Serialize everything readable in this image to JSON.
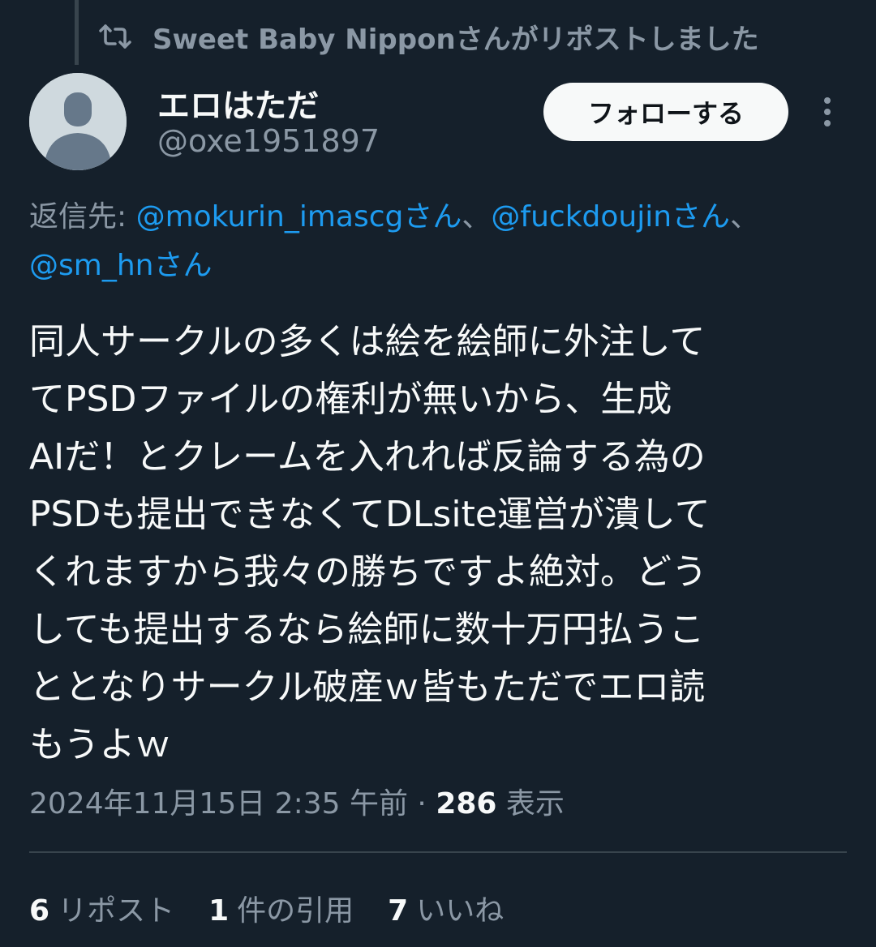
{
  "social_context": {
    "text": "Sweet Baby Nipponさんがリポストしました",
    "icon": "repost-icon"
  },
  "author": {
    "name": "エロはただ",
    "handle": "@oxe1951897",
    "avatar": "default-avatar"
  },
  "follow_button": {
    "label": "フォローする"
  },
  "more_menu": {
    "icon": "more-vertical-icon"
  },
  "reply_to": {
    "prefix": "返信先: ",
    "mentions": [
      "@mokurin_imascgさん",
      "@fuckdoujinさん",
      "@sm_hnさん"
    ],
    "separator": "、"
  },
  "tweet": {
    "lines": [
      "同人サークルの多くは絵を絵師に外注して",
      "てPSDファイルの権利が無いから、生成",
      "AIだ！とクレームを入れれば反論する為の",
      "PSDも提出できなくてDLsite運営が潰して",
      "くれますから我々の勝ちですよ絶対。どう",
      "しても提出するなら絵師に数十万円払うこ",
      "ととなりサークル破産ｗ皆もただでエロ読",
      "もうよｗ"
    ]
  },
  "meta": {
    "timestamp": "2024年11月15日 2:35 午前",
    "dot": " · ",
    "views_count": "286",
    "views_label": " 表示"
  },
  "stats": [
    {
      "count": "6",
      "label": "リポスト"
    },
    {
      "count": "1",
      "label": "件の引用"
    },
    {
      "count": "7",
      "label": "いいね"
    }
  ],
  "colors": {
    "background": "#15202b",
    "text": "#f7f9f9",
    "secondary": "#8b98a5",
    "link": "#1d9bf0"
  }
}
